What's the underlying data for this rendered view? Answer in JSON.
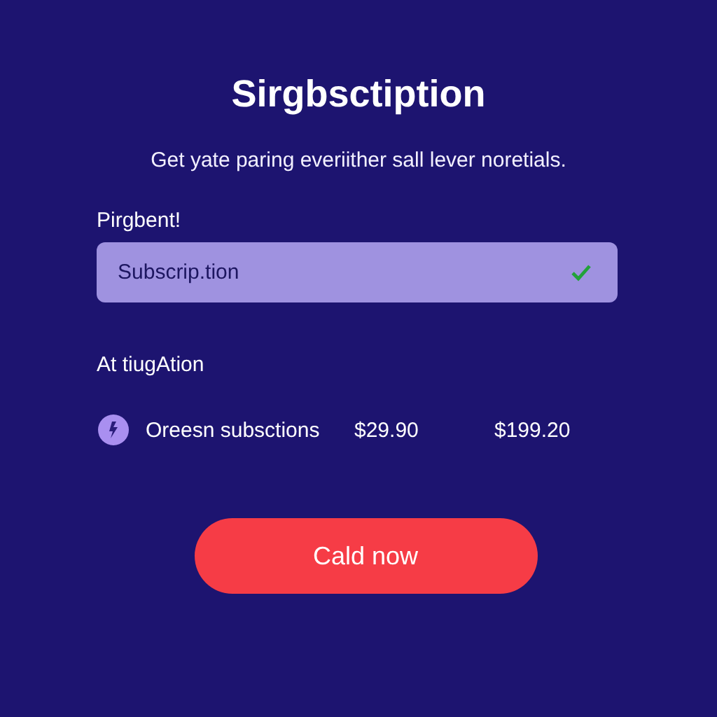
{
  "title": "Sirgbsctiption",
  "subtitle": "Get yate paring everiither sall lever noretials.",
  "field": {
    "label": "Pirgbent!",
    "value": "Subscrip.tion",
    "valid": true
  },
  "section": {
    "title": "At tiugAtion"
  },
  "plans": [
    {
      "name": "Oreesn subsctions",
      "price": "$29.90",
      "total": "$199.20"
    }
  ],
  "button": {
    "label": "Cald now"
  }
}
